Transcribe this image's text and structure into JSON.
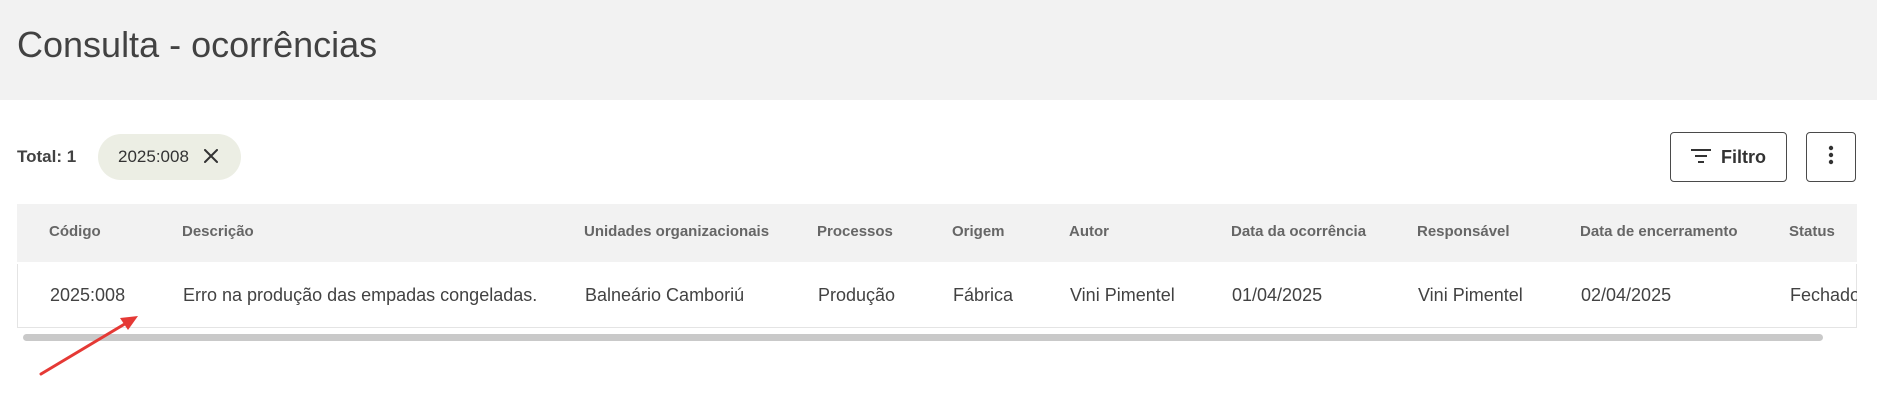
{
  "header": {
    "title": "Consulta - ocorrências"
  },
  "toolbar": {
    "total_label": "Total:",
    "total_value": "1",
    "chip_label": "2025:008",
    "filter_label": "Filtro"
  },
  "table": {
    "columns": [
      "Código",
      "Descrição",
      "Unidades organizacionais",
      "Processos",
      "Origem",
      "Autor",
      "Data da ocorrência",
      "Responsável",
      "Data de encerramento",
      "Status"
    ],
    "rows": [
      [
        "2025:008",
        "Erro na produção das empadas congeladas.",
        "Balneário Camboriú",
        "Produção",
        "Fábrica",
        "Vini Pimentel",
        "01/04/2025",
        "Vini Pimentel",
        "02/04/2025",
        "Fechado"
      ]
    ]
  },
  "colors": {
    "header_bg": "#f2f2f2",
    "chip_bg": "#eceee4",
    "annotation_arrow": "#e53935"
  },
  "icons": {
    "chip_close": "close-icon",
    "filter": "filter-icon",
    "more": "more-vert-icon"
  }
}
